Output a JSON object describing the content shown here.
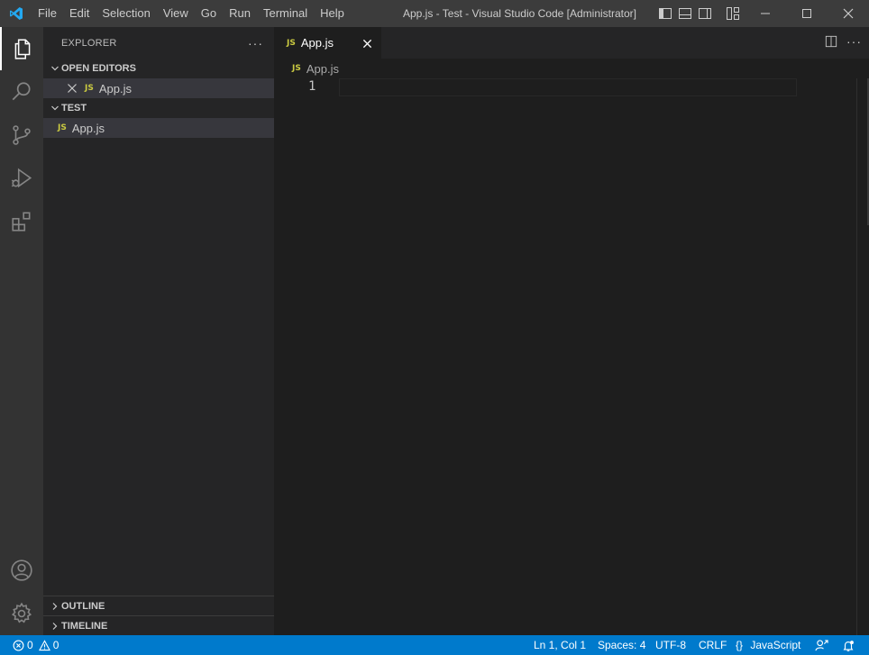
{
  "menu": [
    "File",
    "Edit",
    "Selection",
    "View",
    "Go",
    "Run",
    "Terminal",
    "Help"
  ],
  "window_title": "App.js - Test - Visual Studio Code [Administrator]",
  "sidebar": {
    "title": "EXPLORER",
    "more": "···",
    "open_editors": {
      "label": "OPEN EDITORS",
      "files": [
        {
          "badge": "JS",
          "name": "App.js"
        }
      ]
    },
    "folder": {
      "label": "TEST",
      "files": [
        {
          "badge": "JS",
          "name": "App.js"
        }
      ]
    },
    "outline": "OUTLINE",
    "timeline": "TIMELINE"
  },
  "editor": {
    "tab": {
      "badge": "JS",
      "name": "App.js"
    },
    "breadcrumb": {
      "badge": "JS",
      "name": "App.js"
    },
    "line_numbers": [
      "1"
    ],
    "more": "···"
  },
  "statusbar": {
    "errors": "0",
    "warnings": "0",
    "position": "Ln 1, Col 1",
    "spaces": "Spaces: 4",
    "encoding": "UTF-8",
    "eol": "CRLF",
    "language_icon": "{}",
    "language": "JavaScript"
  },
  "colors": {
    "titlebar": "#3c3c3c",
    "activitybar": "#333333",
    "sidebar": "#252526",
    "editor": "#1e1e1e",
    "statusbar": "#007acc",
    "js_badge": "#cbcb41",
    "vscode_logo": "#23a9f2"
  },
  "icons": {
    "activity": [
      "explorer-icon",
      "search-icon",
      "source-control-icon",
      "run-debug-icon",
      "extensions-icon",
      "accounts-icon",
      "manage-gear-icon"
    ]
  }
}
